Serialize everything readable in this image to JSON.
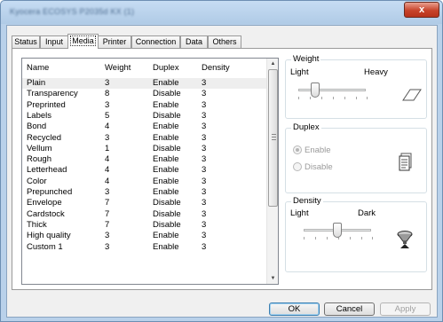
{
  "window": {
    "title": "Kyocera ECOSYS P2035d KX (1)",
    "close_label": "x"
  },
  "tabs": [
    {
      "label": "Status"
    },
    {
      "label": "Input"
    },
    {
      "label": "Media"
    },
    {
      "label": "Printer"
    },
    {
      "label": "Connection"
    },
    {
      "label": "Data"
    },
    {
      "label": "Others"
    }
  ],
  "active_tab": "Media",
  "media_list": {
    "columns": [
      "Name",
      "Weight",
      "Duplex",
      "Density"
    ],
    "rows": [
      {
        "name": "Plain",
        "weight": "3",
        "duplex": "Enable",
        "density": "3"
      },
      {
        "name": "Transparency",
        "weight": "8",
        "duplex": "Disable",
        "density": "3"
      },
      {
        "name": "Preprinted",
        "weight": "3",
        "duplex": "Enable",
        "density": "3"
      },
      {
        "name": "Labels",
        "weight": "5",
        "duplex": "Disable",
        "density": "3"
      },
      {
        "name": "Bond",
        "weight": "4",
        "duplex": "Enable",
        "density": "3"
      },
      {
        "name": "Recycled",
        "weight": "3",
        "duplex": "Enable",
        "density": "3"
      },
      {
        "name": "Vellum",
        "weight": "1",
        "duplex": "Disable",
        "density": "3"
      },
      {
        "name": "Rough",
        "weight": "4",
        "duplex": "Enable",
        "density": "3"
      },
      {
        "name": "Letterhead",
        "weight": "4",
        "duplex": "Enable",
        "density": "3"
      },
      {
        "name": "Color",
        "weight": "4",
        "duplex": "Enable",
        "density": "3"
      },
      {
        "name": "Prepunched",
        "weight": "3",
        "duplex": "Enable",
        "density": "3"
      },
      {
        "name": "Envelope",
        "weight": "7",
        "duplex": "Disable",
        "density": "3"
      },
      {
        "name": "Cardstock",
        "weight": "7",
        "duplex": "Disable",
        "density": "3"
      },
      {
        "name": "Thick",
        "weight": "7",
        "duplex": "Disable",
        "density": "3"
      },
      {
        "name": "High quality",
        "weight": "3",
        "duplex": "Enable",
        "density": "3"
      },
      {
        "name": "Custom 1",
        "weight": "3",
        "duplex": "Enable",
        "density": "3"
      }
    ],
    "selected_row": "Plain"
  },
  "weight_group": {
    "title": "Weight",
    "min_label": "Light",
    "max_label": "Heavy",
    "value_fraction": 0.25,
    "icon": "paper-sheet-icon"
  },
  "duplex_group": {
    "title": "Duplex",
    "options": [
      "Enable",
      "Disable"
    ],
    "selected": "Enable",
    "disabled": true,
    "icon": "duplex-document-icon"
  },
  "density_group": {
    "title": "Density",
    "min_label": "Light",
    "max_label": "Dark",
    "value_fraction": 0.5,
    "icon": "toner-cartridge-icon"
  },
  "buttons": {
    "ok": "OK",
    "cancel": "Cancel",
    "apply": "Apply"
  },
  "colors": {
    "title_bar": "#b9d1ea",
    "close_button": "#c7432a",
    "selection": "#eeeeee"
  }
}
